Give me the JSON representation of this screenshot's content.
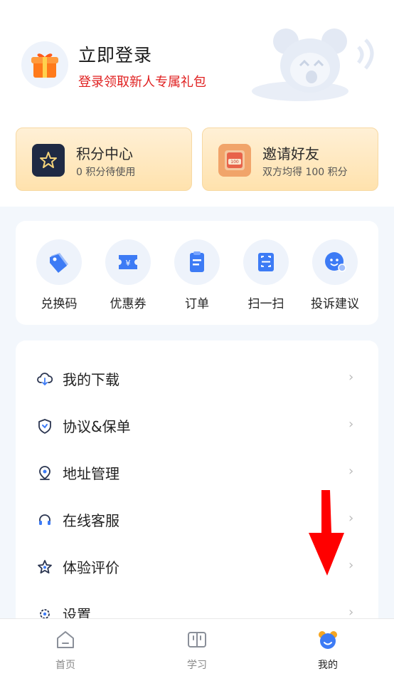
{
  "header": {
    "login_title": "立即登录",
    "login_subtitle": "登录领取新人专属礼包"
  },
  "cards": {
    "points": {
      "title": "积分中心",
      "subtitle": "0 积分待使用"
    },
    "invite": {
      "title": "邀请好友",
      "subtitle": "双方均得 100 积分",
      "badge": "100"
    }
  },
  "quick_actions": [
    {
      "label": "兑换码",
      "icon": "tag-icon"
    },
    {
      "label": "优惠券",
      "icon": "coupon-icon"
    },
    {
      "label": "订单",
      "icon": "order-icon"
    },
    {
      "label": "扫一扫",
      "icon": "scan-icon"
    },
    {
      "label": "投诉建议",
      "icon": "feedback-icon"
    }
  ],
  "menu": [
    {
      "label": "我的下载",
      "icon": "cloud-download-icon"
    },
    {
      "label": "协议&保单",
      "icon": "shield-icon"
    },
    {
      "label": "地址管理",
      "icon": "location-icon"
    },
    {
      "label": "在线客服",
      "icon": "headset-icon"
    },
    {
      "label": "体验评价",
      "icon": "star-icon"
    },
    {
      "label": "设置",
      "icon": "gear-icon"
    }
  ],
  "chevron": "›",
  "tabbar": [
    {
      "label": "首页",
      "icon": "home-icon",
      "active": false
    },
    {
      "label": "学习",
      "icon": "book-icon",
      "active": false
    },
    {
      "label": "我的",
      "icon": "profile-icon",
      "active": true
    }
  ],
  "colors": {
    "accent_red": "#e02020",
    "accent_blue": "#3d7bf5",
    "card_gold": "#ffe2ad",
    "arrow_red": "#ff0000"
  }
}
